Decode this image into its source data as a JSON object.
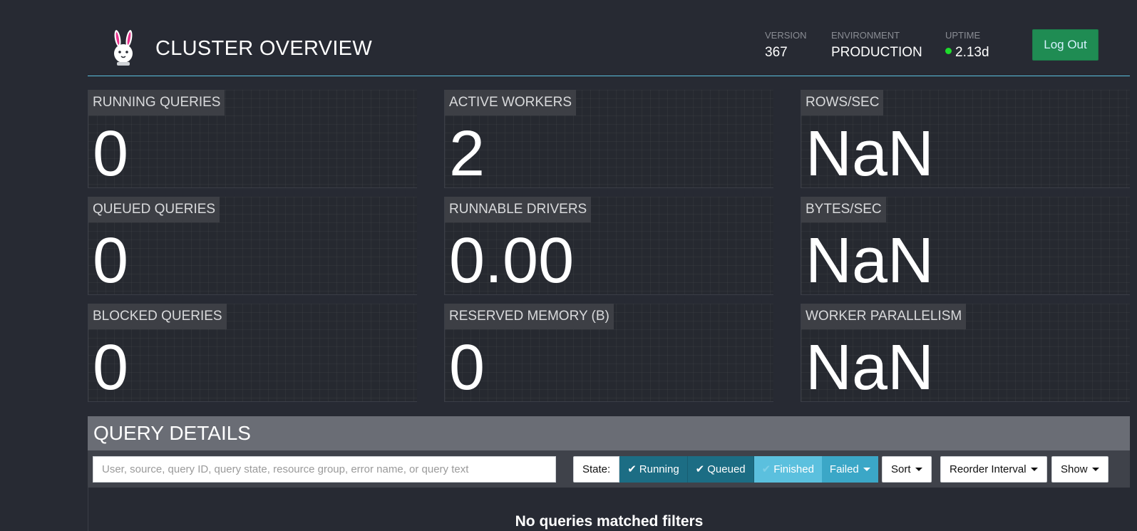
{
  "header": {
    "title": "CLUSTER OVERVIEW",
    "logo_icon": "bunny-logo-icon",
    "version": {
      "label": "VERSION",
      "value": "367"
    },
    "environment": {
      "label": "ENVIRONMENT",
      "value": "PRODUCTION"
    },
    "uptime": {
      "label": "UPTIME",
      "value": "2.13d",
      "status_color": "#1edc2c"
    },
    "logout_label": "Log Out"
  },
  "metrics": [
    {
      "label": "RUNNING QUERIES",
      "value": "0"
    },
    {
      "label": "ACTIVE WORKERS",
      "value": "2"
    },
    {
      "label": "ROWS/SEC",
      "value": "NaN"
    },
    {
      "label": "QUEUED QUERIES",
      "value": "0"
    },
    {
      "label": "RUNNABLE DRIVERS",
      "value": "0.00"
    },
    {
      "label": "BYTES/SEC",
      "value": "NaN"
    },
    {
      "label": "BLOCKED QUERIES",
      "value": "0"
    },
    {
      "label": "RESERVED MEMORY (B)",
      "value": "0"
    },
    {
      "label": "WORKER PARALLELISM",
      "value": "NaN"
    }
  ],
  "query_details": {
    "title": "QUERY DETAILS",
    "search_placeholder": "User, source, query ID, query state, resource group, error name, or query text",
    "state_label": "State:",
    "states": [
      {
        "label": "Running",
        "checked": true
      },
      {
        "label": "Queued",
        "checked": true
      },
      {
        "label": "Finished",
        "checked": false
      },
      {
        "label": "Failed",
        "checked": false
      }
    ],
    "sort_label": "Sort",
    "reorder_label": "Reorder Interval",
    "show_label": "Show",
    "empty_message": "No queries matched filters"
  },
  "colors": {
    "background": "#272a33",
    "accent": "#5bc0de",
    "logout": "#1f8c53",
    "state_active": "#1c6d84"
  }
}
